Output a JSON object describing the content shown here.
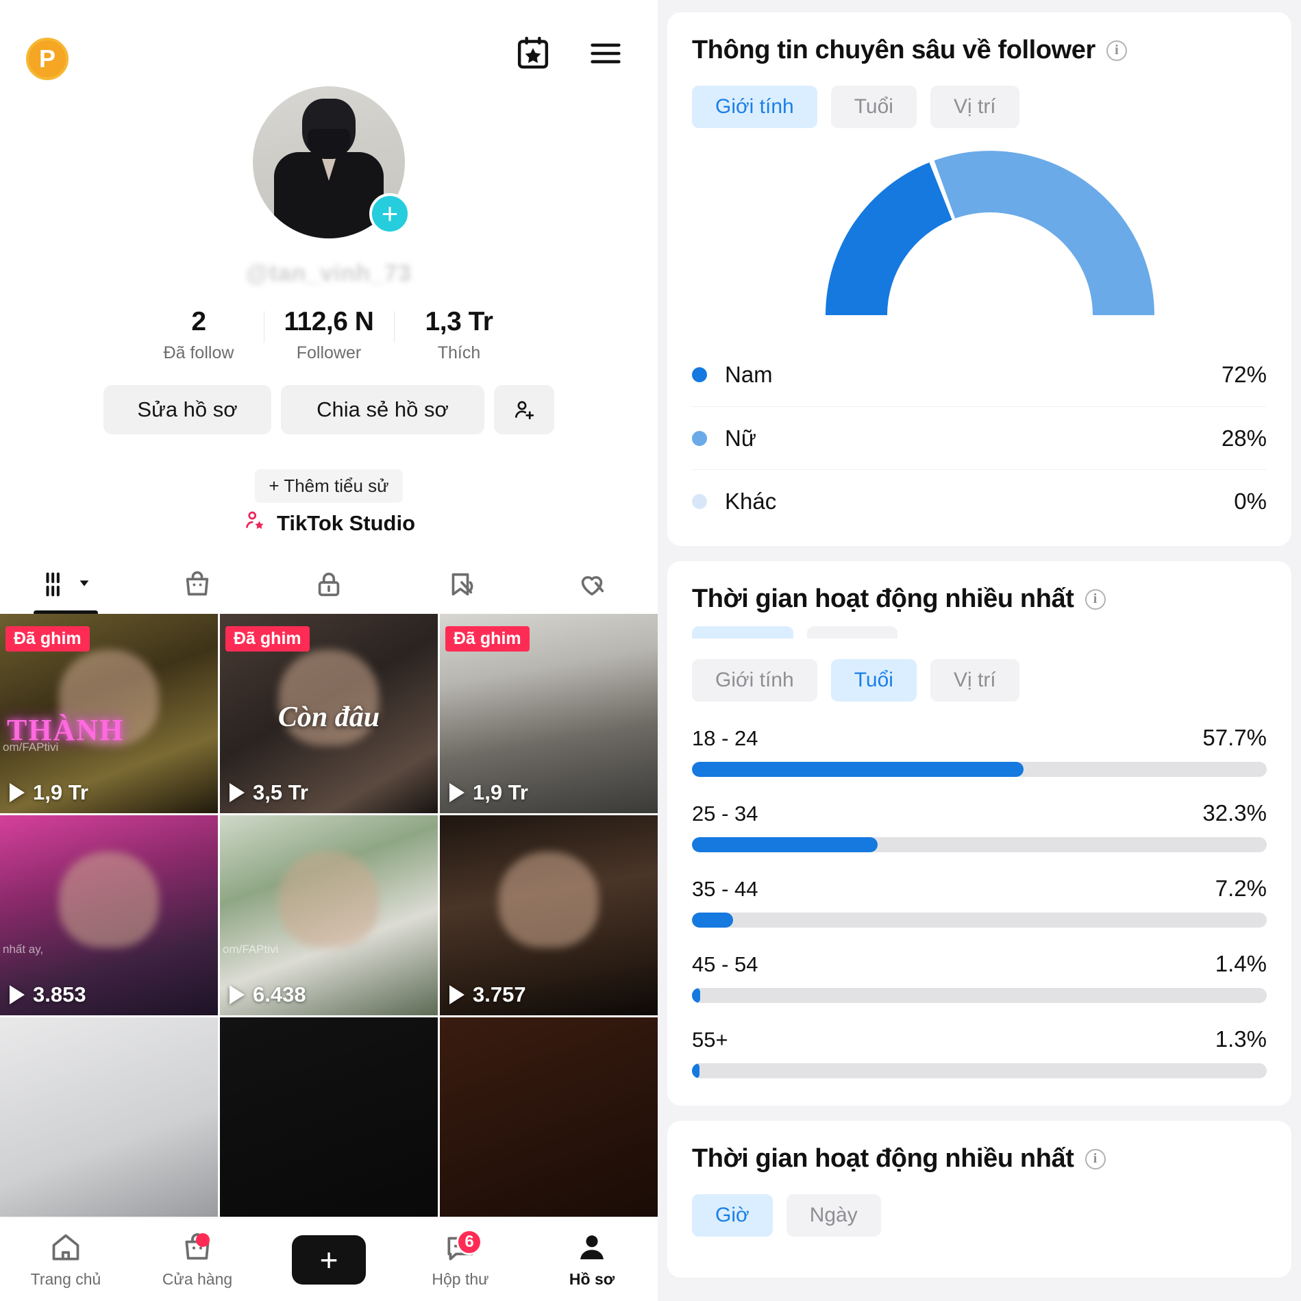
{
  "profile": {
    "coin_badge": "P",
    "username": "@tan_vinh_73",
    "avatar_plus": "+",
    "stats": [
      {
        "num": "2",
        "label": "Đã follow"
      },
      {
        "num": "112,6 N",
        "label": "Follower"
      },
      {
        "num": "1,3 Tr",
        "label": "Thích"
      }
    ],
    "edit_profile": "Sửa hồ sơ",
    "share_profile": "Chia sẻ hồ sơ",
    "add_bio": "+ Thêm tiểu sử",
    "studio": "TikTok Studio",
    "tabs": [
      {
        "name": "posts-tab",
        "icon": "grid-icon",
        "active": true
      },
      {
        "name": "shop-tab",
        "icon": "shopping-bag-icon",
        "active": false
      },
      {
        "name": "private-tab",
        "icon": "lock-icon",
        "active": false
      },
      {
        "name": "reposts-tab",
        "icon": "repost-off-icon",
        "active": false
      },
      {
        "name": "liked-tab",
        "icon": "heart-off-icon",
        "active": false
      }
    ],
    "videos": [
      {
        "pin": "Đã ghim",
        "views": "1,9 Tr",
        "caption": "om/FAPtivi",
        "overlay": "THÀNH"
      },
      {
        "pin": "Đã ghim",
        "views": "3,5 Tr",
        "caption": "",
        "overlay": "Còn đâu"
      },
      {
        "pin": "Đã ghim",
        "views": "1,9 Tr",
        "caption": "",
        "overlay": ""
      },
      {
        "pin": "",
        "views": "3.853",
        "caption": "nhất ay,",
        "overlay": ""
      },
      {
        "pin": "",
        "views": "6.438",
        "caption": "om/FAPtivi",
        "overlay": ""
      },
      {
        "pin": "",
        "views": "3.757",
        "caption": "",
        "overlay": ""
      }
    ]
  },
  "bottom_nav": [
    {
      "label": "Trang chủ",
      "icon": "home-icon",
      "active": false,
      "badge": ""
    },
    {
      "label": "Cửa hàng",
      "icon": "shop-bag-icon",
      "active": false,
      "badge": "dot"
    },
    {
      "label": "",
      "icon": "create-plus-icon",
      "active": false,
      "badge": ""
    },
    {
      "label": "Hộp thư",
      "icon": "inbox-icon",
      "active": false,
      "badge": "6"
    },
    {
      "label": "Hồ sơ",
      "icon": "person-icon",
      "active": true,
      "badge": ""
    }
  ],
  "analytics": {
    "follower_card": {
      "title": "Thông tin chuyên sâu về follower",
      "info": "i",
      "segments": [
        {
          "label": "Giới tính",
          "active": true
        },
        {
          "label": "Tuổi",
          "active": false
        },
        {
          "label": "Vị trí",
          "active": false
        }
      ],
      "legend": [
        {
          "name": "Nam",
          "value": "72%",
          "color": "#1579e0"
        },
        {
          "name": "Nữ",
          "value": "28%",
          "color": "#6aaae8"
        },
        {
          "name": "Khác",
          "value": "0%",
          "color": "#d7e7f8"
        }
      ]
    },
    "age_card": {
      "title": "Thời gian hoạt động nhiều nhất",
      "info": "i",
      "segments": [
        {
          "label": "Giới tính",
          "active": false
        },
        {
          "label": "Tuổi",
          "active": true
        },
        {
          "label": "Vị trí",
          "active": false
        }
      ],
      "bars": [
        {
          "label": "18 - 24",
          "value": "57.7%",
          "pct": 57.7
        },
        {
          "label": "25 - 34",
          "value": "32.3%",
          "pct": 32.3
        },
        {
          "label": "35 - 44",
          "value": "7.2%",
          "pct": 7.2
        },
        {
          "label": "45 - 54",
          "value": "1.4%",
          "pct": 1.4
        },
        {
          "label": "55+",
          "value": "1.3%",
          "pct": 1.3
        }
      ]
    },
    "time_card": {
      "title": "Thời gian hoạt động nhiều nhất",
      "info": "i",
      "segments": [
        {
          "label": "Giờ",
          "active": true
        },
        {
          "label": "Ngày",
          "active": false
        }
      ]
    }
  },
  "chart_data": [
    {
      "type": "pie",
      "title": "Thông tin chuyên sâu về follower — Giới tính",
      "labels": [
        "Nam",
        "Nữ",
        "Khác"
      ],
      "values": [
        72,
        28,
        0
      ],
      "unit": "%",
      "colors": [
        "#1579e0",
        "#6aaae8",
        "#d7e7f8"
      ],
      "legend": "bottom",
      "variant": "half-donut-gauge"
    },
    {
      "type": "bar",
      "orientation": "horizontal",
      "title": "Thời gian hoạt động nhiều nhất — Tuổi",
      "categories": [
        "18 - 24",
        "25 - 34",
        "35 - 44",
        "45 - 54",
        "55+"
      ],
      "values": [
        57.7,
        32.3,
        7.2,
        1.4,
        1.3
      ],
      "unit": "%",
      "xlim": [
        0,
        100
      ],
      "ylabel": "",
      "xlabel": "",
      "grid": false,
      "bar_color": "#1579e0",
      "track_color": "#e2e2e4"
    }
  ]
}
